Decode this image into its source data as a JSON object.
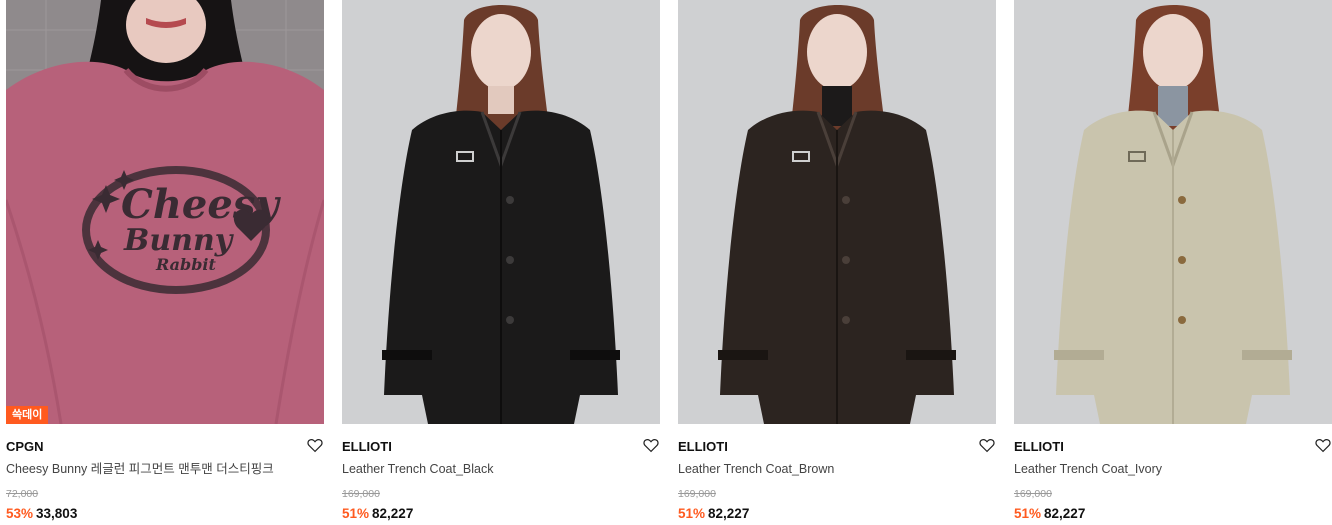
{
  "products": [
    {
      "badge": "쓱데이",
      "brand": "CPGN",
      "title": "Cheesy Bunny 레글런 피그먼트 맨투맨 더스티핑크",
      "original_price": "72,000",
      "discount": "53%",
      "price": "33,803",
      "print_lines": [
        "Cheesy",
        "Bunny",
        "Rabbit"
      ],
      "colors": {
        "bg": "#8f8a8c",
        "garment": "#b7617a",
        "print": "#3a2b33"
      }
    },
    {
      "brand": "ELLIOTI",
      "title": "Leather Trench Coat_Black",
      "original_price": "169,000",
      "discount": "51%",
      "price": "82,227",
      "colors": {
        "bg": "#cfd0d2",
        "garment": "#1b1a1a"
      }
    },
    {
      "brand": "ELLIOTI",
      "title": "Leather Trench Coat_Brown",
      "original_price": "169,000",
      "discount": "51%",
      "price": "82,227",
      "colors": {
        "bg": "#cfd0d2",
        "garment": "#2c2420"
      }
    },
    {
      "brand": "ELLIOTI",
      "title": "Leather Trench Coat_Ivory",
      "original_price": "169,000",
      "discount": "51%",
      "price": "82,227",
      "colors": {
        "bg": "#cfd0d2",
        "garment": "#c9c4ad"
      }
    }
  ],
  "accent_color": "#ff5a1f",
  "icons": {
    "wishlist": "heart-outline-icon"
  }
}
